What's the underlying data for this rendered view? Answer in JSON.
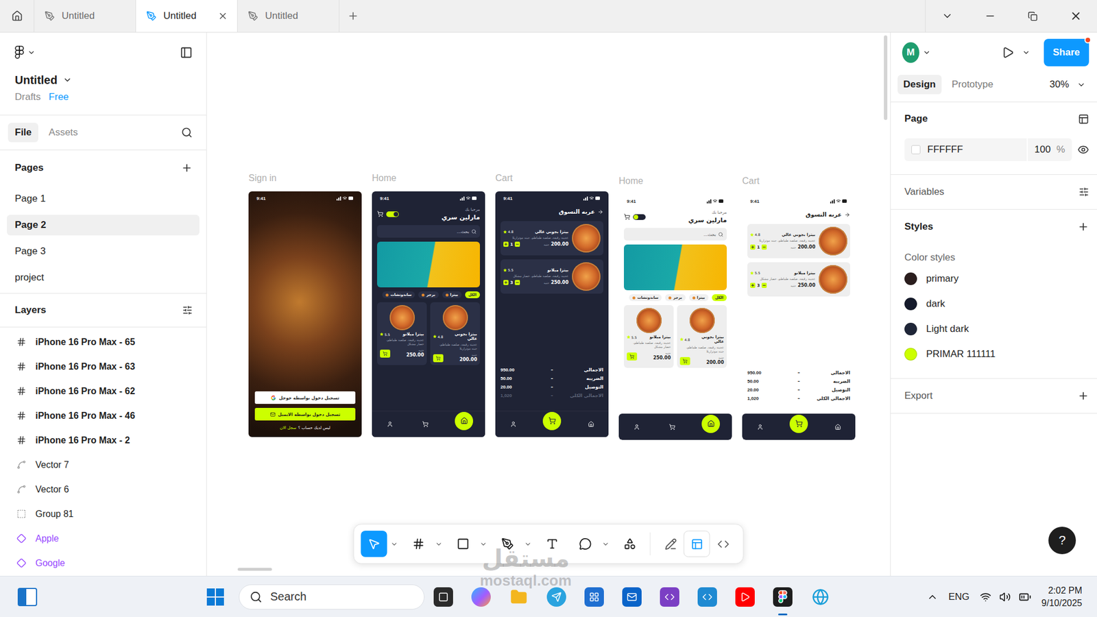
{
  "title_bar": {
    "tabs": [
      {
        "label": "Untitled",
        "selected": false
      },
      {
        "label": "Untitled",
        "selected": true
      },
      {
        "label": "Untitled",
        "selected": false
      }
    ]
  },
  "left_panel": {
    "file_name": "Untitled",
    "location": "Drafts",
    "plan": "Free",
    "tabs": [
      {
        "label": "File",
        "selected": true
      },
      {
        "label": "Assets",
        "selected": false
      }
    ],
    "pages_title": "Pages",
    "pages": [
      {
        "label": "Page 1",
        "selected": false
      },
      {
        "label": "Page 2",
        "selected": true
      },
      {
        "label": "Page 3",
        "selected": false
      },
      {
        "label": "project",
        "selected": false
      }
    ],
    "layers_title": "Layers",
    "layers": [
      {
        "name": "iPhone 16 Pro Max - 65",
        "kind": "frame"
      },
      {
        "name": "iPhone 16 Pro Max - 63",
        "kind": "frame"
      },
      {
        "name": "iPhone 16 Pro Max - 62",
        "kind": "frame"
      },
      {
        "name": "iPhone 16 Pro Max - 46",
        "kind": "frame"
      },
      {
        "name": "iPhone 16 Pro Max - 2",
        "kind": "frame"
      },
      {
        "name": "Vector 7",
        "kind": "vector"
      },
      {
        "name": "Vector 6",
        "kind": "vector"
      },
      {
        "name": "Group 81",
        "kind": "group"
      },
      {
        "name": "Apple",
        "kind": "component"
      },
      {
        "name": "Google",
        "kind": "component"
      }
    ]
  },
  "canvas": {
    "frames": [
      {
        "label": "Sign in",
        "screen": "sign_in",
        "theme": "dark"
      },
      {
        "label": "Home",
        "screen": "home",
        "theme": "dark",
        "toggle_on": true,
        "nav": [
          {
            "selected": false
          },
          {
            "selected": false
          },
          {
            "selected": true
          }
        ]
      },
      {
        "label": "Cart",
        "screen": "cart",
        "theme": "dark",
        "total_dimmed": true,
        "nav": [
          {
            "selected": false
          },
          {
            "selected": true
          },
          {
            "selected": false
          }
        ]
      },
      {
        "label": "Home",
        "screen": "home",
        "theme": "light",
        "toggle_on": false,
        "nav": [
          {
            "selected": false
          },
          {
            "selected": false
          },
          {
            "selected": true
          }
        ]
      },
      {
        "label": "Cart",
        "screen": "cart",
        "theme": "light",
        "total_dimmed": false,
        "nav": [
          {
            "selected": false
          },
          {
            "selected": true
          },
          {
            "selected": false
          }
        ]
      }
    ],
    "screens": {
      "status_time": "9:41",
      "sign_in": {
        "google": "تسجيل دخول بواسطه جوجل",
        "email": "تسجيل دخول بواسطه الايميل",
        "no_account": "ليس لديك حساب ؟",
        "register": "سجل الان"
      },
      "home": {
        "greeting": "مرحبا بك",
        "name": "مارلين سري",
        "search": "بحث...",
        "categories": [
          {
            "label": "الكل",
            "selected": true
          },
          {
            "label": "بيتزا",
            "selected": false
          },
          {
            "label": "برجر",
            "selected": false
          },
          {
            "label": "ساندوتشات",
            "selected": false
          }
        ],
        "products": [
          {
            "name": "بيتزا بجوني عالي",
            "rating": "4.8",
            "description": "عجينة رقيقة، صلصة طماطم، جبنه موتزاريلا",
            "currency": "جنيه",
            "price": "200.00"
          },
          {
            "name": "بيتزا ميلانو",
            "rating": "5.5",
            "description": "عجينة رقيقة، صلصة طماطم، خضار مشكل",
            "currency": "جنيه",
            "price": "250.00"
          }
        ]
      },
      "cart": {
        "title": "عربه التسوق",
        "items": [
          {
            "name": "بيتزا بجوني عالي",
            "rating": "4.8",
            "description": "عجينة رقيقة، صلصة طماطم، جبنه موتزاريلا",
            "quantity": "1",
            "currency": "جنيه",
            "price": "200.00"
          },
          {
            "name": "بيتزا ميلانو",
            "rating": "5.5",
            "description": "عجينة رقيقة، صلصة طماطم، خضار مشكل",
            "quantity": "3",
            "currency": "جنيه",
            "price": "250.00"
          }
        ],
        "separator": "–",
        "totals": [
          {
            "label": "الاجمالي",
            "value": "950.00",
            "grand": false
          },
          {
            "label": "الضريبه",
            "value": "50.00",
            "grand": false
          },
          {
            "label": "التوصيل",
            "value": "20.00",
            "grand": false
          },
          {
            "label": "الاجمالي الكلي",
            "value": "1,020",
            "grand": true
          }
        ]
      }
    },
    "toolbar": {
      "tools": [
        {
          "selected": true
        },
        {
          "selected": false
        },
        {
          "selected": false
        },
        {
          "selected": false
        },
        {
          "selected": false
        },
        {
          "selected": false
        },
        {
          "selected": false
        }
      ],
      "modes": [
        {
          "selected": false
        },
        {
          "selected": true
        },
        {
          "selected": false
        }
      ]
    }
  },
  "right_panel": {
    "avatar": "M",
    "share": "Share",
    "tabs": [
      {
        "label": "Design",
        "selected": true
      },
      {
        "label": "Prototype",
        "selected": false
      }
    ],
    "zoom": "30%",
    "page": {
      "title": "Page",
      "color": "FFFFFF",
      "opacity": "100",
      "unit": "%"
    },
    "variables": "Variables",
    "styles": "Styles",
    "color_styles_title": "Color styles",
    "color_styles": [
      {
        "name": "primary",
        "color": "#2b1e1e"
      },
      {
        "name": "dark",
        "color": "#151a2b"
      },
      {
        "name": "Light dark",
        "color": "#1f2638"
      },
      {
        "name": "PRIMAR 111111",
        "color": "#ccff00"
      }
    ],
    "export": "Export",
    "help": "?"
  },
  "taskbar": {
    "search": "Search",
    "language": "ENG",
    "time": "2:02 PM",
    "date": "9/10/2025",
    "apps": [
      {
        "selected": false
      },
      {
        "selected": false
      },
      {
        "selected": false
      },
      {
        "selected": false
      },
      {
        "selected": false
      },
      {
        "selected": false
      },
      {
        "selected": false
      },
      {
        "selected": false
      },
      {
        "selected": false
      },
      {
        "selected": true
      },
      {
        "selected": false
      }
    ]
  },
  "watermark": {
    "logo": "مستقل",
    "site": "mostaql.com"
  }
}
